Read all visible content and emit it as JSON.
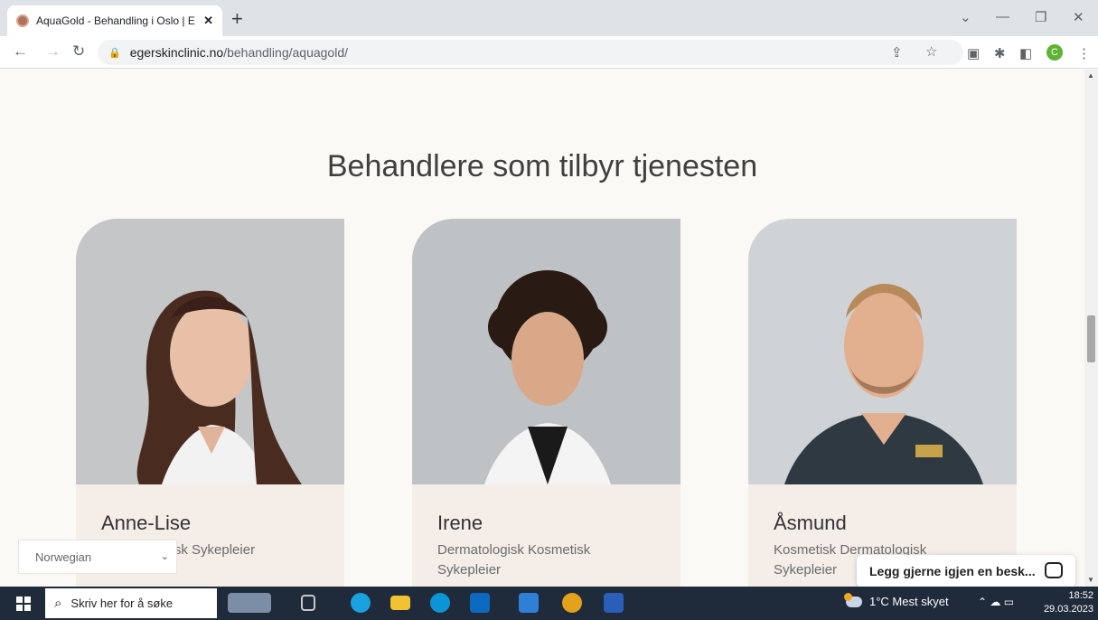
{
  "browser": {
    "tab_title": "AquaGold - Behandling i Oslo | E",
    "tab_close": "✕",
    "new_tab": "+",
    "url_host": "egerskinclinic.no",
    "url_path": "/behandling/aquagold/",
    "profile_initial": "C"
  },
  "page": {
    "heading": "Behandlere som tilbyr tjenesten",
    "practitioners": [
      {
        "name": "Anne-Lise",
        "role": "Dermatologisk Sykepleier"
      },
      {
        "name": "Irene",
        "role": "Dermatologisk Kosmetisk Sykepleier"
      },
      {
        "name": "Åsmund",
        "role": "Kosmetisk Dermatologisk Sykepleier"
      }
    ]
  },
  "language_select": {
    "value": "Norwegian"
  },
  "chat": {
    "label": "Legg gjerne igjen en besk..."
  },
  "taskbar": {
    "search_placeholder": "Skriv her for å søke",
    "weather": "1°C  Mest skyet",
    "time": "18:52",
    "date": "29.03.2023"
  },
  "colors": {
    "page_bg": "#fbf9f6",
    "card_info_bg": "#f4ede8",
    "taskbar_bg": "#1f2a3a"
  }
}
